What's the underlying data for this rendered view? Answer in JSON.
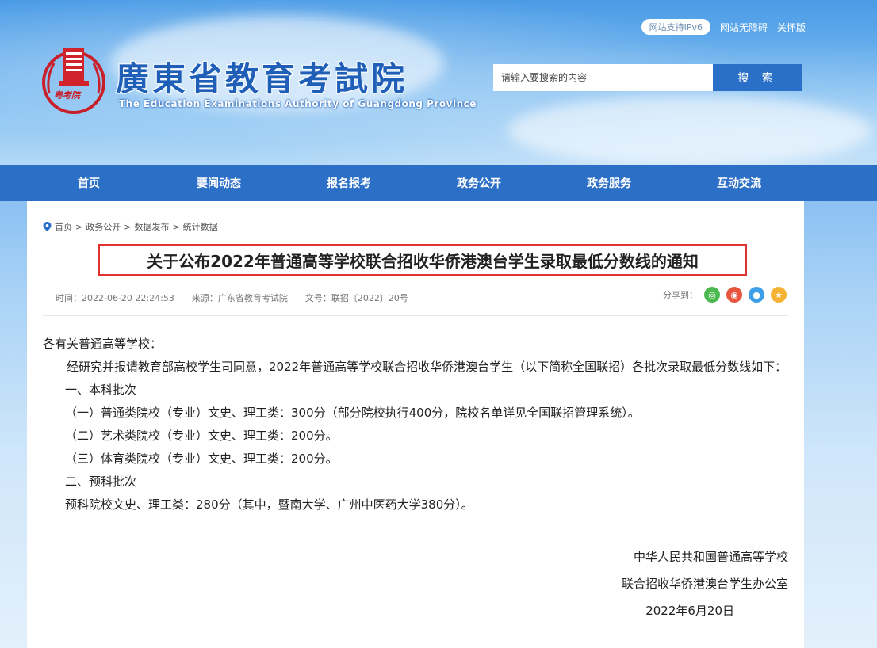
{
  "header": {
    "site_title": "廣東省教育考試院",
    "site_subtitle": "The Education Examinations Authority of Guangdong Province",
    "ipv6_badge": "网站支持IPv6",
    "accessibility_link": "网站无障碍",
    "care_mode_link": "关怀版",
    "search_placeholder": "请输入要搜索的内容",
    "search_button": "搜 索",
    "logo_text": "粤考院"
  },
  "nav": {
    "items": [
      "首页",
      "要闻动态",
      "报名报考",
      "政务公开",
      "政务服务",
      "互动交流"
    ]
  },
  "breadcrumb": [
    "首页",
    "政务公开",
    "数据发布",
    "统计数据"
  ],
  "article": {
    "title": "关于公布2022年普通高等学校联合招收华侨港澳台学生录取最低分数线的通知",
    "time": "时间：2022-06-20 22:24:53",
    "source": "来源：广东省教育考试院",
    "doc_no": "文号：联招〔2022〕20号",
    "share_label": "分享到：",
    "paragraphs": [
      "各有关普通高等学校：",
      "经研究并报请教育部高校学生司同意，2022年普通高等学校联合招收华侨港澳台学生（以下简称全国联招）各批次录取最低分数线如下：",
      "一、本科批次",
      "（一）普通类院校（专业）文史、理工类：300分（部分院校执行400分，院校名单详见全国联招管理系统）。",
      "（二）艺术类院校（专业）文史、理工类：200分。",
      "（三）体育类院校（专业）文史、理工类：200分。",
      "二、预科批次",
      "预科院校文史、理工类：280分（其中，暨南大学、广州中医药大学380分）。"
    ],
    "signature": [
      "中华人民共和国普通高等学校",
      "联合招收华侨港澳台学生办公室",
      "2022年6月20日"
    ]
  },
  "colors": {
    "nav_bg": "#2b6fc6",
    "title_border": "#e03030",
    "brand_blue": "#1f5fb8"
  }
}
